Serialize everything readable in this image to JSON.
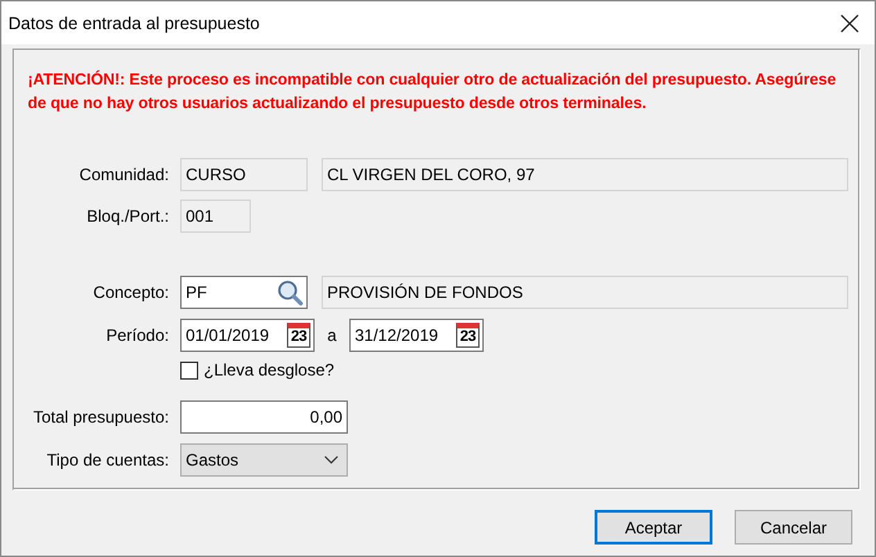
{
  "window": {
    "title": "Datos de entrada al presupuesto"
  },
  "warning": "¡ATENCIÓN!: Este proceso es incompatible con cualquier otro de actualización del presupuesto. Asegúrese de que no hay otros usuarios actualizando el presupuesto desde otros terminales.",
  "comunidad": {
    "label": "Comunidad:",
    "code": "CURSO",
    "name": "CL VIRGEN DEL CORO, 97"
  },
  "bloque": {
    "label": "Bloq./Port.:",
    "value": "001"
  },
  "concepto": {
    "label": "Concepto:",
    "code": "PF",
    "name": "PROVISIÓN DE FONDOS"
  },
  "periodo": {
    "label": "Período:",
    "from": "01/01/2019",
    "separator": "a",
    "to": "31/12/2019",
    "from_calendar_day": "23",
    "to_calendar_day": "23"
  },
  "desglose": {
    "label": "¿Lleva desglose?",
    "checked": false
  },
  "total": {
    "label": "Total presupuesto:",
    "value": "0,00"
  },
  "tipo": {
    "label": "Tipo de cuentas:",
    "value": "Gastos"
  },
  "buttons": [
    {
      "label": "Aceptar",
      "default": true
    },
    {
      "label": "Cancelar",
      "default": false
    }
  ]
}
